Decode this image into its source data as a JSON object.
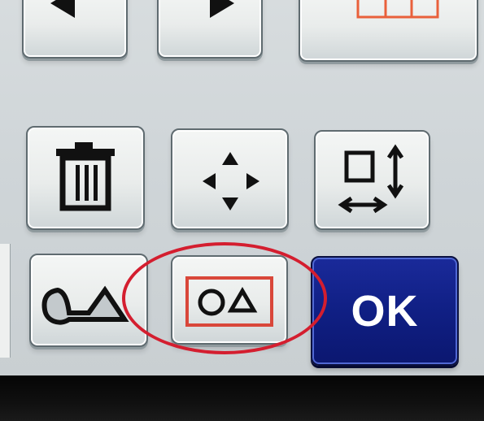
{
  "screen": {
    "buttons": [
      {
        "id": "previous",
        "icon": "arrow-left-icon"
      },
      {
        "id": "next",
        "icon": "arrow-right-icon"
      },
      {
        "id": "pattern-layout",
        "icon": "frame-grid-icon",
        "accent": "#e9603b"
      },
      {
        "id": "delete",
        "icon": "trash-icon"
      },
      {
        "id": "move",
        "icon": "four-way-arrow-icon"
      },
      {
        "id": "resize",
        "icon": "resize-icon"
      },
      {
        "id": "combine-shapes",
        "icon": "circle-triangle-joined-icon"
      },
      {
        "id": "group-shapes",
        "icon": "circle-triangle-framed-icon",
        "accent": "#d9473a"
      },
      {
        "id": "ok",
        "label": "OK",
        "color": "#101f84"
      }
    ],
    "highlight": {
      "color": "#d41e2f",
      "target": "group-shapes"
    }
  }
}
